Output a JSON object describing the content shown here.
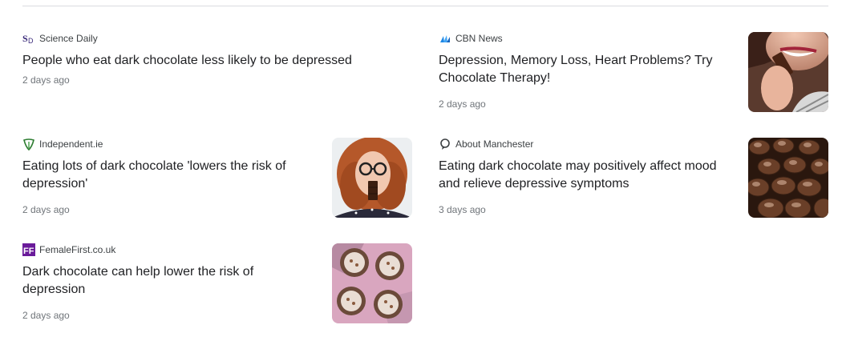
{
  "articles": [
    {
      "source": "Science Daily",
      "source_icon": "science-daily-logo-icon",
      "headline": "People who eat dark chocolate less likely to be depressed",
      "time": "2 days ago"
    },
    {
      "source": "CBN News",
      "source_icon": "cbn-news-logo-icon",
      "headline": "Depression, Memory Loss, Heart Problems? Try Chocolate Therapy!",
      "time": "2 days ago",
      "thumbnail": "woman-eating-chocolate-photo"
    },
    {
      "source": "Independent.ie",
      "source_icon": "independent-logo-icon",
      "headline": "Eating lots of dark chocolate 'lowers the risk of depression'",
      "time": "2 days ago",
      "thumbnail": "red-haired-woman-with-chocolate-photo"
    },
    {
      "source": "About Manchester",
      "source_icon": "location-pin-icon",
      "headline": "Eating dark chocolate may positively affect mood and relieve depressive symptoms",
      "time": "3 days ago",
      "thumbnail": "chocolate-truffles-photo"
    },
    {
      "source": "FemaleFirst.co.uk",
      "source_icon": "femalefirst-logo-icon",
      "headline": "Dark chocolate can help lower the risk of depression",
      "time": "2 days ago",
      "thumbnail": "chocolate-desserts-photo"
    }
  ],
  "colors": {
    "headline": "#202124",
    "meta": "#70757a",
    "divider": "#dadce0",
    "femalefirst_brand": "#6a1b9a",
    "independent_brand": "#2e7d32",
    "cbn_brand": "#1e88e5"
  }
}
